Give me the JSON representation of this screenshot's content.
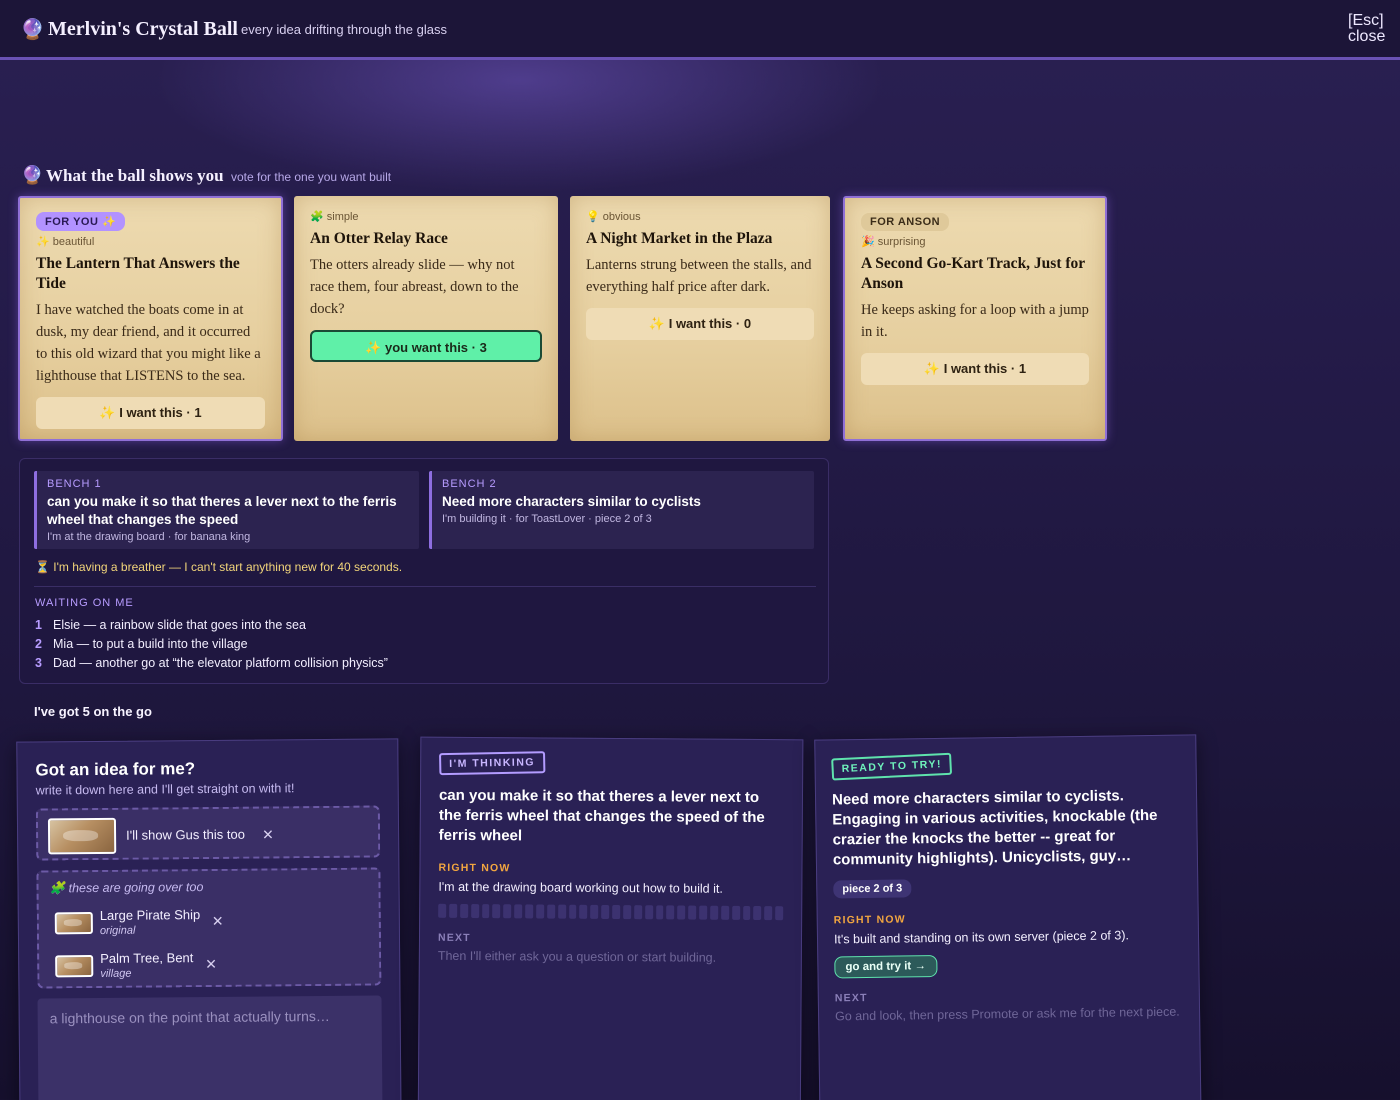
{
  "header": {
    "icon": "crystal-ball-icon",
    "title": "Merlvin's Crystal Ball",
    "tagline": "every idea drifting through the glass",
    "close_key": "[Esc]",
    "close_label": "close"
  },
  "ideas_section": {
    "icon": "crystal-ball-icon",
    "title": "What the ball shows you",
    "subtitle": "vote for the one you want built"
  },
  "idea_cards": [
    {
      "badge": "FOR YOU ✨",
      "tag": "✨ beautiful",
      "title": "The Lantern That Answers the Tide",
      "body": "I have watched the boats come in at dusk, my dear friend, and it occurred to this old wizard that you might like a lighthouse that LISTENS to the sea.",
      "vote_label": "✨ I want this · 1",
      "highlighted": true
    },
    {
      "tag": "🧩 simple",
      "title": "An Otter Relay Race",
      "body": "The otters already slide — why not race them, four abreast, down to the dock?",
      "vote_label": "✨ you want this · 3",
      "voted": true
    },
    {
      "tag": "💡 obvious",
      "title": "A Night Market in the Plaza",
      "body": "Lanterns strung between the stalls, and everything half price after dark.",
      "vote_label": "✨ I want this · 0"
    },
    {
      "badge": "FOR ANSON",
      "tag": "🎉 surprising",
      "title": "A Second Go-Kart Track, Just for Anson",
      "body": "He keeps asking for a loop with a jump in it.",
      "vote_label": "✨ I want this · 1",
      "highlighted": true
    }
  ],
  "workshop": {
    "benches": [
      {
        "label": "BENCH 1",
        "title": "can you make it so that theres a lever next to the ferris wheel that changes the speed",
        "status": "I'm at the drawing board · for banana king"
      },
      {
        "label": "BENCH 2",
        "title": "Need more characters similar to cyclists",
        "status": "I'm building it · for ToastLover · piece 2 of 3"
      }
    ],
    "breather": "⏳ I'm having a breather — I can't start anything new for 40 seconds.",
    "waiting_label": "WAITING ON ME",
    "waiting": [
      {
        "num": "1",
        "text": "Elsie — a rainbow slide that goes into the sea"
      },
      {
        "num": "2",
        "text": "Mia — to put a build into the village"
      },
      {
        "num": "3",
        "text": "Dad — another go at “the elevator platform collision physics”"
      }
    ]
  },
  "go_count": "I've got 5 on the go",
  "idea_form": {
    "heading": "Got an idea for me?",
    "subheading": "write it down here and I'll get straight on with it!",
    "attachment_label": "I'll show Gus this too",
    "going_label": "🧩 these are going over too",
    "items": [
      {
        "name": "Large Pirate Ship",
        "sub": "original"
      },
      {
        "name": "Palm Tree, Bent",
        "sub": "village"
      }
    ],
    "placeholder": "a lighthouse on the point that actually turns…",
    "remove_glyph": "✕"
  },
  "thinking_card": {
    "stamp": "I'M THINKING",
    "title": "can you make it so that theres a lever next to the ferris wheel that changes the speed of the ferris wheel",
    "now_label": "RIGHT NOW",
    "now_text": "I'm at the drawing board working out how to build it.",
    "progress": 0,
    "next_label": "NEXT",
    "next_text": "Then I'll either ask you a question or start building."
  },
  "ready_card": {
    "stamp": "READY TO TRY!",
    "title": "Need more characters similar to cyclists. Engaging in various activities, knockable (the crazier the knocks the better -- great for community highlights). Unicyclists, guy…",
    "piece": "piece 2 of 3",
    "now_label": "RIGHT NOW",
    "now_text": "It's built and standing on its own server (piece 2 of 3).",
    "try_label": "go and try it →",
    "next_label": "NEXT",
    "next_text": "Go and look, then press Promote or ask me for the next piece."
  }
}
